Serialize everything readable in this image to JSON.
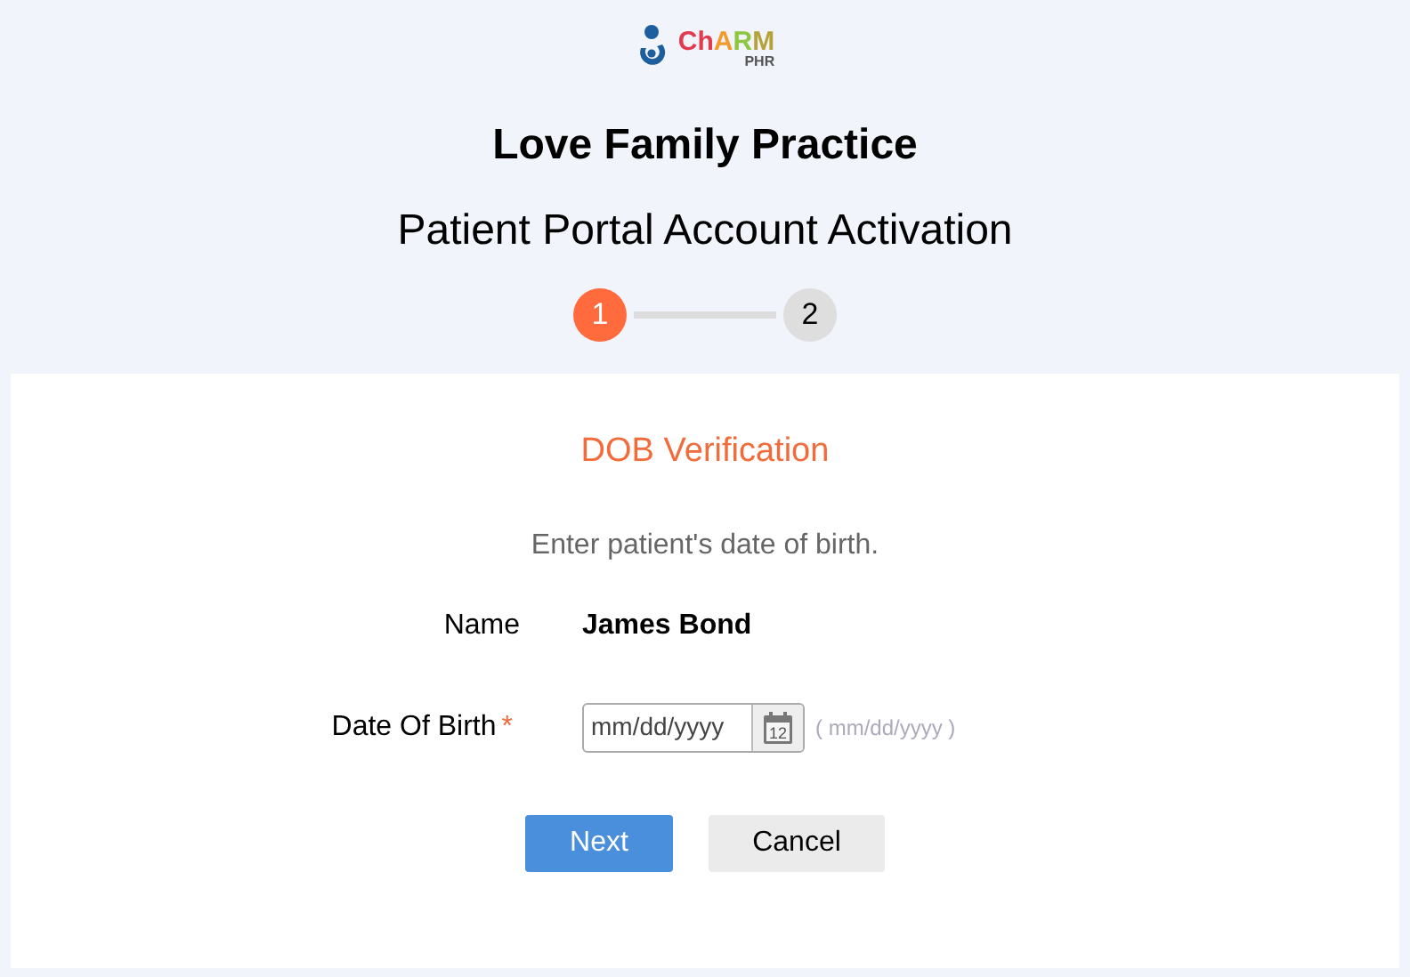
{
  "logo": {
    "letters": [
      {
        "text": "Ch",
        "color": "#e23a4e"
      },
      {
        "text": "A",
        "color": "#f39a2b"
      },
      {
        "text": "R",
        "color": "#8dc63f"
      },
      {
        "text": "M",
        "color": "#b5a33a"
      }
    ],
    "subtitle": "PHR"
  },
  "practice_name": "Love Family Practice",
  "page_title": "Patient Portal Account Activation",
  "steps": [
    {
      "label": "1",
      "selected": true
    },
    {
      "label": "2",
      "selected": false
    }
  ],
  "card": {
    "heading": "DOB Verification",
    "instruction": "Enter patient's date of birth.",
    "fields": [
      {
        "kind": "text",
        "label": "Name",
        "value": "James Bond",
        "required": false
      },
      {
        "kind": "date",
        "label": "Date Of Birth",
        "required": true,
        "required_mark": "*",
        "placeholder": "mm/dd/yyyy",
        "calendar_day": "12",
        "hint": "( mm/dd/yyyy )"
      }
    ],
    "buttons": [
      {
        "label": "Next",
        "kind": "primary"
      },
      {
        "label": "Cancel",
        "kind": "secondary"
      }
    ]
  }
}
